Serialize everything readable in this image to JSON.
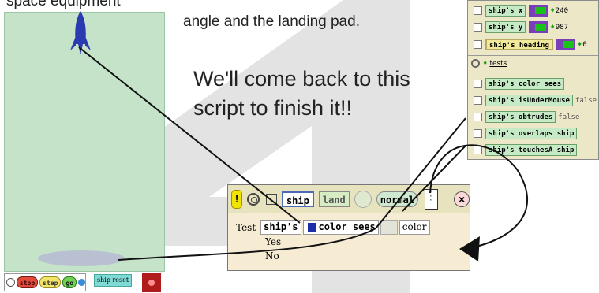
{
  "top_caption_left": "space equipment",
  "top_caption_right": "angle and the landing pad.",
  "big_caption_line1": "We'll come back to this",
  "big_caption_line2": "script to finish it!!",
  "viewer": {
    "rows": [
      {
        "label": "ship's x",
        "value": "240"
      },
      {
        "label": "ship's y",
        "value": "987"
      },
      {
        "label": "ship's heading",
        "value": "0"
      }
    ],
    "tests_label": "tests",
    "tests": [
      {
        "label": "ship's color sees",
        "value": ""
      },
      {
        "label": "ship's isUnderMouse",
        "value": "false"
      },
      {
        "label": "ship's obtrudes",
        "value": "false"
      },
      {
        "label": "ship's overlaps ship",
        "value": ""
      },
      {
        "label": "ship's touchesA ship",
        "value": ""
      }
    ]
  },
  "script": {
    "bang": "!",
    "object": "ship",
    "name": "land",
    "status": "normal",
    "close": "×",
    "test_label": "Test",
    "tile_ships": "ship's",
    "tile_color_sees": "color sees",
    "color_label": "color",
    "yes": "Yes",
    "no": "No"
  },
  "controls": {
    "stop": "stop",
    "step": "step",
    "go": "go",
    "ship_reset": "ship reset"
  },
  "colors": {
    "stage": "#c5e3c9",
    "viewer_bg": "#ece7c6",
    "swatch": "#1c2fa8",
    "rocket": "#2a3ab0"
  }
}
